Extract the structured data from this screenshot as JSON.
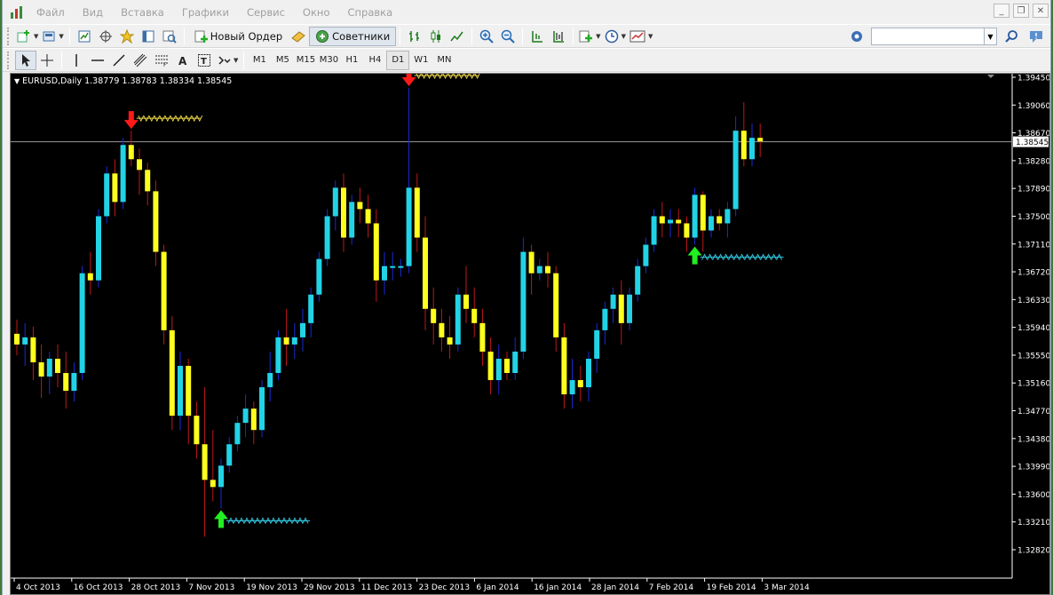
{
  "menu": {
    "items": [
      "Файл",
      "Вид",
      "Вставка",
      "Графики",
      "Сервис",
      "Окно",
      "Справка"
    ]
  },
  "toolbar": {
    "new_order_label": "Новый Ордер",
    "experts_label": "Советники",
    "search_placeholder": ""
  },
  "timeframes": [
    "M1",
    "M5",
    "M15",
    "M30",
    "H1",
    "H4",
    "D1",
    "W1",
    "MN"
  ],
  "active_timeframe": "D1",
  "chart": {
    "symbol_info": "EURUSD,Daily  1.38779 1.38783 1.38334 1.38545",
    "current_price": "1.38545",
    "price_levels": [
      "1.39450",
      "1.39060",
      "1.38670",
      "1.38280",
      "1.37890",
      "1.37500",
      "1.37110",
      "1.36720",
      "1.36330",
      "1.35940",
      "1.35550",
      "1.35160",
      "1.34770",
      "1.34380",
      "1.33990",
      "1.33600",
      "1.33210",
      "1.32820"
    ],
    "date_labels": [
      "4 Oct 2013",
      "16 Oct 2013",
      "28 Oct 2013",
      "7 Nov 2013",
      "19 Nov 2013",
      "29 Nov 2013",
      "11 Dec 2013",
      "23 Dec 2013",
      "6 Jan 2014",
      "16 Jan 2014",
      "28 Jan 2014",
      "7 Feb 2014",
      "19 Feb 2014",
      "3 Mar 2014"
    ],
    "colors": {
      "background": "#000000",
      "bull_body": "#22d3e6",
      "bear_body": "#ffff1e",
      "bull_wick": "#1a2ad8",
      "bear_wick": "#c01818",
      "sell_arrow": "#ff1a1a",
      "buy_arrow": "#22ee22",
      "sell_hatch": "#e6d24a",
      "buy_hatch": "#33c8e0"
    },
    "candles": [
      [
        1.3585,
        1.3605,
        1.3555,
        1.357
      ],
      [
        1.357,
        1.36,
        1.354,
        1.358
      ],
      [
        1.358,
        1.3595,
        1.352,
        1.3545
      ],
      [
        1.3545,
        1.357,
        1.3495,
        1.3525
      ],
      [
        1.3525,
        1.356,
        1.35,
        1.355
      ],
      [
        1.355,
        1.357,
        1.351,
        1.353
      ],
      [
        1.353,
        1.356,
        1.348,
        1.3505
      ],
      [
        1.3505,
        1.3545,
        1.349,
        1.353
      ],
      [
        1.353,
        1.368,
        1.352,
        1.367
      ],
      [
        1.367,
        1.37,
        1.364,
        1.366
      ],
      [
        1.366,
        1.376,
        1.365,
        1.375
      ],
      [
        1.375,
        1.382,
        1.374,
        1.381
      ],
      [
        1.381,
        1.383,
        1.375,
        1.377
      ],
      [
        1.377,
        1.386,
        1.376,
        1.385
      ],
      [
        1.385,
        1.387,
        1.382,
        1.383
      ],
      [
        1.383,
        1.3845,
        1.378,
        1.3815
      ],
      [
        1.3815,
        1.3825,
        1.3765,
        1.3785
      ],
      [
        1.3785,
        1.38,
        1.368,
        1.37
      ],
      [
        1.37,
        1.371,
        1.357,
        1.359
      ],
      [
        1.359,
        1.361,
        1.345,
        1.347
      ],
      [
        1.347,
        1.356,
        1.345,
        1.354
      ],
      [
        1.354,
        1.355,
        1.343,
        1.347
      ],
      [
        1.347,
        1.349,
        1.341,
        1.343
      ],
      [
        1.343,
        1.351,
        1.33,
        1.338
      ],
      [
        1.338,
        1.345,
        1.335,
        1.337
      ],
      [
        1.337,
        1.341,
        1.334,
        1.34
      ],
      [
        1.34,
        1.344,
        1.339,
        1.343
      ],
      [
        1.343,
        1.347,
        1.342,
        1.346
      ],
      [
        1.346,
        1.35,
        1.344,
        1.348
      ],
      [
        1.348,
        1.349,
        1.343,
        1.345
      ],
      [
        1.345,
        1.352,
        1.344,
        1.351
      ],
      [
        1.351,
        1.356,
        1.349,
        1.353
      ],
      [
        1.353,
        1.359,
        1.352,
        1.358
      ],
      [
        1.358,
        1.362,
        1.354,
        1.357
      ],
      [
        1.357,
        1.36,
        1.355,
        1.358
      ],
      [
        1.358,
        1.362,
        1.356,
        1.36
      ],
      [
        1.36,
        1.365,
        1.358,
        1.364
      ],
      [
        1.364,
        1.37,
        1.363,
        1.369
      ],
      [
        1.369,
        1.376,
        1.368,
        1.375
      ],
      [
        1.375,
        1.38,
        1.373,
        1.379
      ],
      [
        1.379,
        1.381,
        1.37,
        1.372
      ],
      [
        1.372,
        1.378,
        1.371,
        1.377
      ],
      [
        1.377,
        1.379,
        1.374,
        1.376
      ],
      [
        1.376,
        1.378,
        1.372,
        1.374
      ],
      [
        1.374,
        1.376,
        1.363,
        1.366
      ],
      [
        1.366,
        1.37,
        1.364,
        1.368
      ],
      [
        1.368,
        1.37,
        1.366,
        1.368
      ],
      [
        1.368,
        1.369,
        1.3665,
        1.368
      ],
      [
        1.368,
        1.393,
        1.367,
        1.379
      ],
      [
        1.379,
        1.381,
        1.37,
        1.372
      ],
      [
        1.372,
        1.375,
        1.359,
        1.362
      ],
      [
        1.362,
        1.365,
        1.357,
        1.36
      ],
      [
        1.36,
        1.362,
        1.356,
        1.358
      ],
      [
        1.358,
        1.361,
        1.355,
        1.357
      ],
      [
        1.357,
        1.365,
        1.356,
        1.364
      ],
      [
        1.364,
        1.368,
        1.36,
        1.362
      ],
      [
        1.362,
        1.365,
        1.358,
        1.36
      ],
      [
        1.36,
        1.362,
        1.354,
        1.356
      ],
      [
        1.356,
        1.358,
        1.35,
        1.352
      ],
      [
        1.352,
        1.357,
        1.35,
        1.355
      ],
      [
        1.355,
        1.356,
        1.352,
        1.353
      ],
      [
        1.353,
        1.358,
        1.352,
        1.356
      ],
      [
        1.356,
        1.372,
        1.355,
        1.37
      ],
      [
        1.37,
        1.371,
        1.364,
        1.367
      ],
      [
        1.367,
        1.369,
        1.366,
        1.368
      ],
      [
        1.368,
        1.37,
        1.365,
        1.367
      ],
      [
        1.367,
        1.368,
        1.356,
        1.358
      ],
      [
        1.358,
        1.36,
        1.348,
        1.35
      ],
      [
        1.35,
        1.355,
        1.348,
        1.352
      ],
      [
        1.352,
        1.354,
        1.349,
        1.351
      ],
      [
        1.351,
        1.356,
        1.349,
        1.355
      ],
      [
        1.355,
        1.36,
        1.353,
        1.359
      ],
      [
        1.359,
        1.363,
        1.357,
        1.362
      ],
      [
        1.362,
        1.365,
        1.36,
        1.364
      ],
      [
        1.364,
        1.366,
        1.357,
        1.36
      ],
      [
        1.36,
        1.365,
        1.359,
        1.364
      ],
      [
        1.364,
        1.369,
        1.363,
        1.368
      ],
      [
        1.368,
        1.372,
        1.367,
        1.371
      ],
      [
        1.371,
        1.376,
        1.37,
        1.375
      ],
      [
        1.375,
        1.377,
        1.372,
        1.374
      ],
      [
        1.374,
        1.376,
        1.372,
        1.3745
      ],
      [
        1.3745,
        1.376,
        1.372,
        1.374
      ],
      [
        1.374,
        1.375,
        1.37,
        1.372
      ],
      [
        1.372,
        1.379,
        1.371,
        1.378
      ],
      [
        1.378,
        1.3785,
        1.37,
        1.373
      ],
      [
        1.373,
        1.376,
        1.372,
        1.375
      ],
      [
        1.375,
        1.376,
        1.373,
        1.374
      ],
      [
        1.374,
        1.377,
        1.372,
        1.376
      ],
      [
        1.376,
        1.389,
        1.375,
        1.387
      ],
      [
        1.387,
        1.391,
        1.382,
        1.383
      ],
      [
        1.383,
        1.388,
        1.382,
        1.386
      ],
      [
        1.386,
        1.388,
        1.3833,
        1.3855
      ]
    ],
    "sell_signals": [
      14,
      48
    ],
    "buy_signals": [
      25,
      83
    ]
  }
}
